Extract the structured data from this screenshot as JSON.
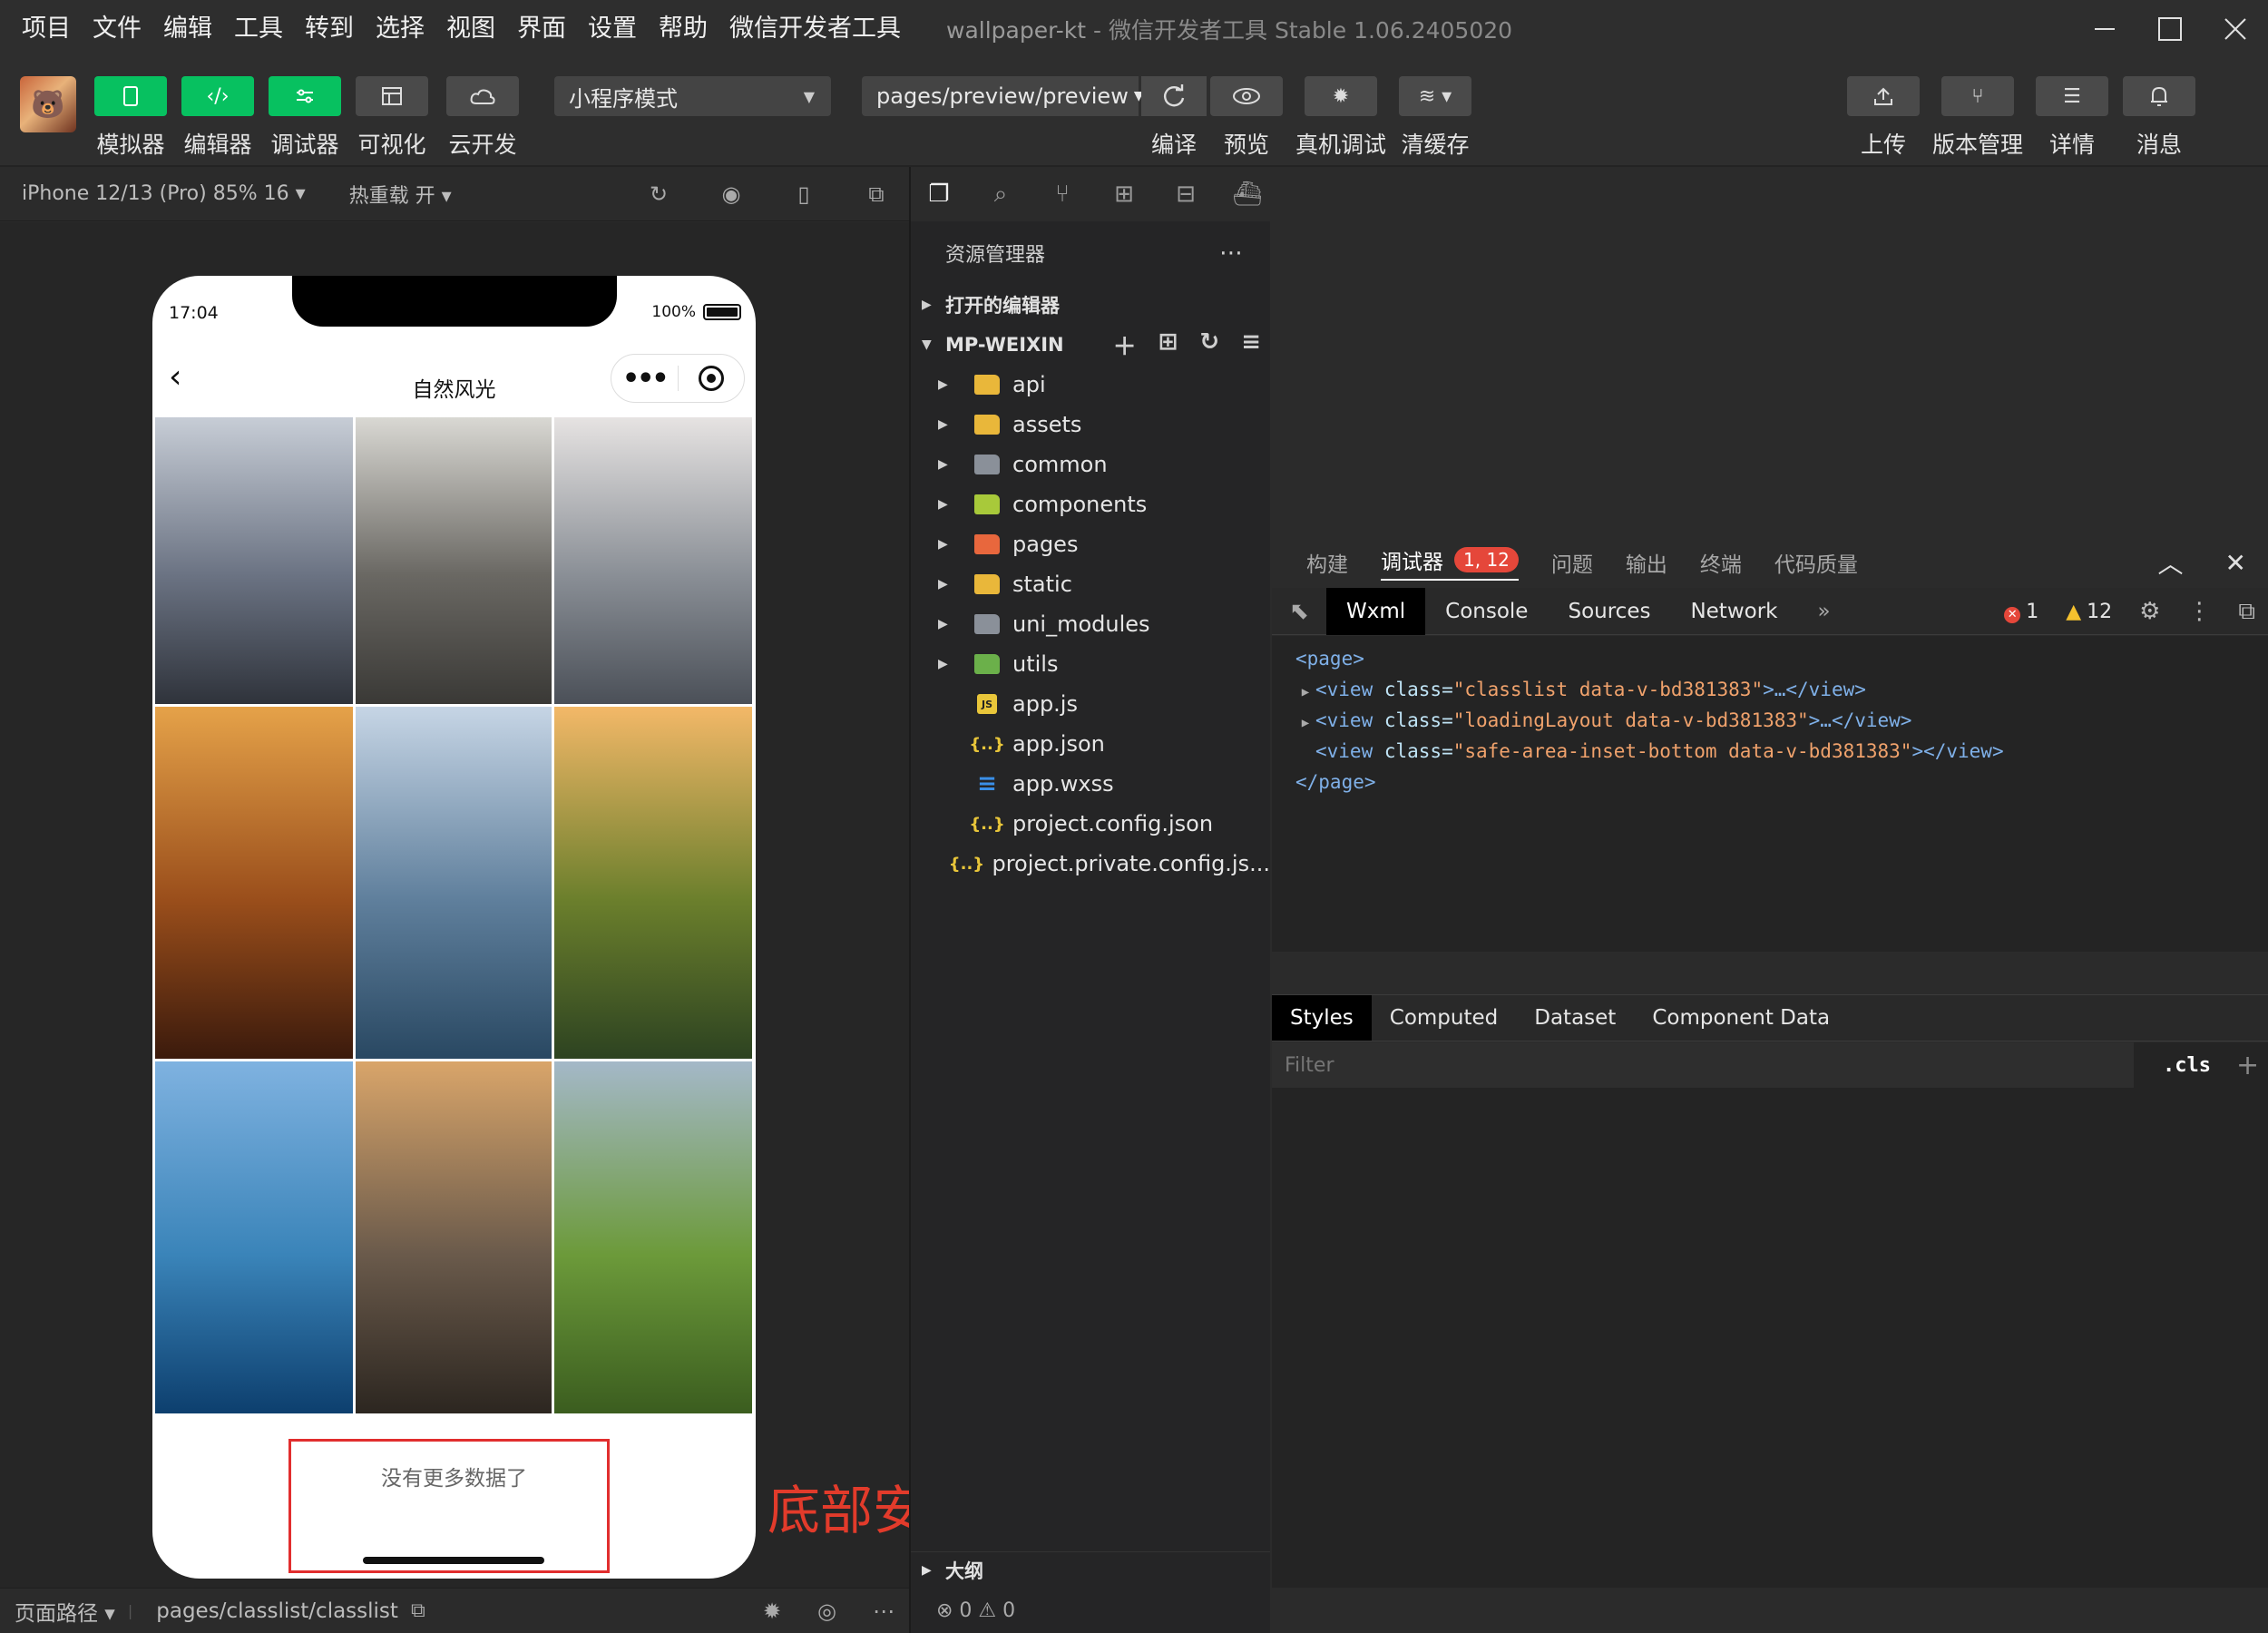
{
  "menu": [
    "项目",
    "文件",
    "编辑",
    "工具",
    "转到",
    "选择",
    "视图",
    "界面",
    "设置",
    "帮助",
    "微信开发者工具"
  ],
  "window": {
    "project": "wallpaper-kt",
    "separator": " - ",
    "app": "微信开发者工具 Stable 1.06.2405020"
  },
  "toolbar": {
    "simulator": "模拟器",
    "editor": "编辑器",
    "debugger": "调试器",
    "visual": "可视化",
    "cloud": "云开发",
    "mode": "小程序模式",
    "page_path": "pages/preview/preview",
    "compile": "编译",
    "preview": "预览",
    "remote_debug": "真机调试",
    "clear_cache": "清缓存",
    "upload": "上传",
    "version": "版本管理",
    "details": "详情",
    "messages": "消息"
  },
  "simulator": {
    "device": "iPhone 12/13 (Pro) 85% 16 ▾",
    "hot_reload": "热重载 开 ▾",
    "bottom_label": "页面路径 ▾",
    "bottom_path": "pages/classlist/classlist"
  },
  "phone": {
    "time": "17:04",
    "battery": "100%",
    "battery_level": 1.0,
    "nav_title": "自然风光",
    "no_more": "没有更多数据了",
    "tiles": [
      {
        "name": "mountain-mist-photo",
        "colors": [
          "#c7cdd6",
          "#6b7383",
          "#2f333b"
        ]
      },
      {
        "name": "rocky-peak-photo",
        "colors": [
          "#d9d8d3",
          "#6a6863",
          "#3a3936"
        ]
      },
      {
        "name": "cloud-peak-photo",
        "colors": [
          "#e6e3e2",
          "#8a8f96",
          "#4b5058"
        ]
      },
      {
        "name": "desert-dusk-photo",
        "colors": [
          "#e5a249",
          "#9a4e1b",
          "#3b1a0c"
        ]
      },
      {
        "name": "snow-mountain-lake-photo",
        "colors": [
          "#c6d5e5",
          "#5f7f9c",
          "#294862"
        ]
      },
      {
        "name": "sunset-forest-photo",
        "colors": [
          "#f3b868",
          "#6b7f2c",
          "#2d4321"
        ]
      },
      {
        "name": "alpine-lake-photo",
        "colors": [
          "#7fb2e0",
          "#3a84b9",
          "#0d3f6e"
        ]
      },
      {
        "name": "stone-window-sunset-photo",
        "colors": [
          "#d9a56a",
          "#6a5a4b",
          "#2c2620"
        ]
      },
      {
        "name": "green-valley-photo",
        "colors": [
          "#a4b8c8",
          "#6c9a3a",
          "#3b5d1f"
        ]
      }
    ]
  },
  "annotation": {
    "label": "底部安全区",
    "color": "#e12e2e"
  },
  "explorer": {
    "title": "资源管理器",
    "open_editors": "打开的编辑器",
    "project": "MP-WEIXIN",
    "items": [
      {
        "label": "api",
        "folder": true,
        "color": "#e9b73a"
      },
      {
        "label": "assets",
        "folder": true,
        "color": "#e9b73a"
      },
      {
        "label": "common",
        "folder": true,
        "color": "#8a9099"
      },
      {
        "label": "components",
        "folder": true,
        "color": "#a8c93a"
      },
      {
        "label": "pages",
        "folder": true,
        "color": "#e8673d"
      },
      {
        "label": "static",
        "folder": true,
        "color": "#e9b73a"
      },
      {
        "label": "uni_modules",
        "folder": true,
        "color": "#8a9099"
      },
      {
        "label": "utils",
        "folder": true,
        "color": "#6bb04a"
      },
      {
        "label": "app.js",
        "folder": false,
        "icon": "JS",
        "color": "#e9c63a"
      },
      {
        "label": "app.json",
        "folder": false,
        "icon": "{..}",
        "color": "#e9c63a"
      },
      {
        "label": "app.wxss",
        "folder": false,
        "icon": "≡",
        "color": "#3a8fe8"
      },
      {
        "label": "project.config.json",
        "folder": false,
        "icon": "{..}",
        "color": "#e9c63a"
      },
      {
        "label": "project.private.config.js...",
        "folder": false,
        "icon": "{..}",
        "color": "#e9c63a"
      }
    ],
    "outline": "大纲",
    "problems": "⊗ 0 ⚠ 0"
  },
  "debugger": {
    "tabs": [
      "构建",
      "调试器",
      "问题",
      "输出",
      "终端",
      "代码质量"
    ],
    "badge": "1, 12",
    "dev_tabs": [
      "Wxml",
      "Console",
      "Sources",
      "Network"
    ],
    "more": "»",
    "errors": "1",
    "warnings": "12",
    "wxml": {
      "open": "<page>",
      "close": "</page>",
      "nodes": [
        {
          "open": "<view ",
          "attr": "class=",
          "value": "\"classlist data-v-bd381383\"",
          "tail": ">…</view>",
          "collapsible": true
        },
        {
          "open": "<view ",
          "attr": "class=",
          "value": "\"loadingLayout data-v-bd381383\"",
          "tail": ">…</view>",
          "collapsible": true
        },
        {
          "open": "<view ",
          "attr": "class=",
          "value": "\"safe-area-inset-bottom data-v-bd381383\"",
          "tail": "></view>",
          "collapsible": false
        }
      ]
    },
    "style_tabs": [
      "Styles",
      "Computed",
      "Dataset",
      "Component Data"
    ],
    "filter_placeholder": "Filter",
    "cls": ".cls",
    "plus": "+"
  }
}
